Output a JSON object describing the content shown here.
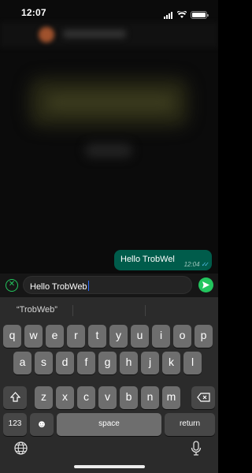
{
  "status": {
    "time": "12:07"
  },
  "chat": {
    "message": {
      "text": "Hello TrobWel",
      "time": "12:04",
      "ticks": "✓✓"
    }
  },
  "composer": {
    "value": "Hello TrobWeb"
  },
  "keyboard": {
    "suggestion": "“TrobWeb”",
    "row1": [
      "q",
      "w",
      "e",
      "r",
      "t",
      "y",
      "u",
      "i",
      "o",
      "p"
    ],
    "row2": [
      "a",
      "s",
      "d",
      "f",
      "g",
      "h",
      "j",
      "k",
      "l"
    ],
    "row3": [
      "z",
      "x",
      "c",
      "v",
      "b",
      "n",
      "m"
    ],
    "numbers_label": "123",
    "space_label": "space",
    "return_label": "return"
  },
  "icons": [
    "signal-icon",
    "wifi-icon",
    "battery-icon",
    "close-icon",
    "send-icon",
    "shift-icon",
    "backspace-icon",
    "emoji-icon",
    "globe-icon",
    "mic-icon"
  ],
  "colors": {
    "accent": "#23c55e",
    "bubble": "#005c4b",
    "read_ticks": "#53bdeb"
  }
}
